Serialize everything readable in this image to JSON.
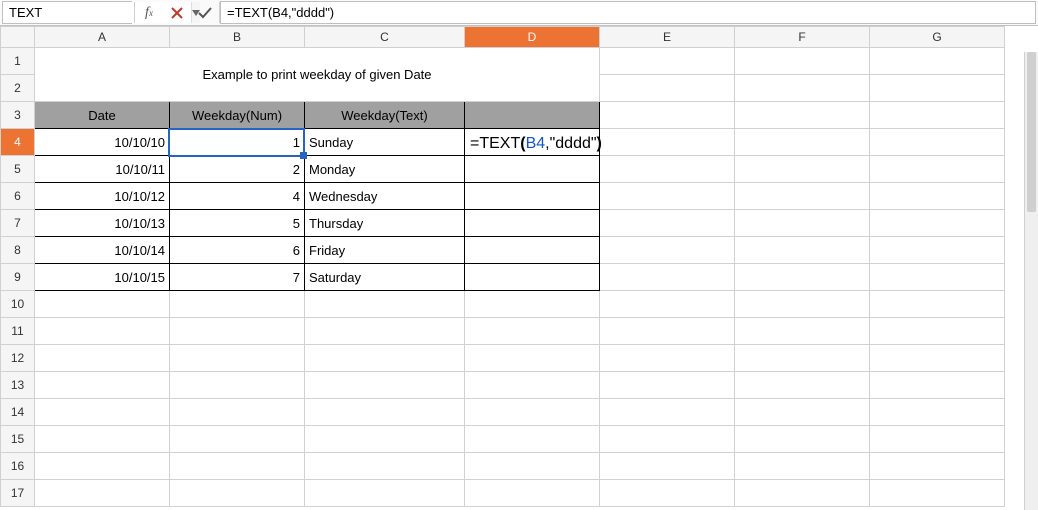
{
  "formula_bar": {
    "name_box_value": "TEXT",
    "formula_value": "=TEXT(B4,\"dddd\")"
  },
  "columns": [
    "A",
    "B",
    "C",
    "D",
    "E",
    "F",
    "G"
  ],
  "row_count": 17,
  "active": {
    "col": "D",
    "row": 4
  },
  "ref_highlight": {
    "col": "B",
    "row": 4
  },
  "content": {
    "title": "Example to print weekday of given Date",
    "headers": {
      "date": "Date",
      "wnum": "Weekday(Num)",
      "wtext": "Weekday(Text)"
    },
    "rows": [
      {
        "date": "10/10/10",
        "wnum": "1",
        "wtext": "Sunday"
      },
      {
        "date": "10/10/11",
        "wnum": "2",
        "wtext": "Monday"
      },
      {
        "date": "10/10/12",
        "wnum": "4",
        "wtext": "Wednesday"
      },
      {
        "date": "10/10/13",
        "wnum": "5",
        "wtext": "Thursday"
      },
      {
        "date": "10/10/14",
        "wnum": "6",
        "wtext": "Friday"
      },
      {
        "date": "10/10/15",
        "wnum": "7",
        "wtext": "Saturday"
      }
    ],
    "editing_cell_display": {
      "prefix": "=TEXT",
      "open": "(",
      "ref": "B4",
      "comma": ",",
      "str": "\"dddd\"",
      "close": ")"
    }
  }
}
